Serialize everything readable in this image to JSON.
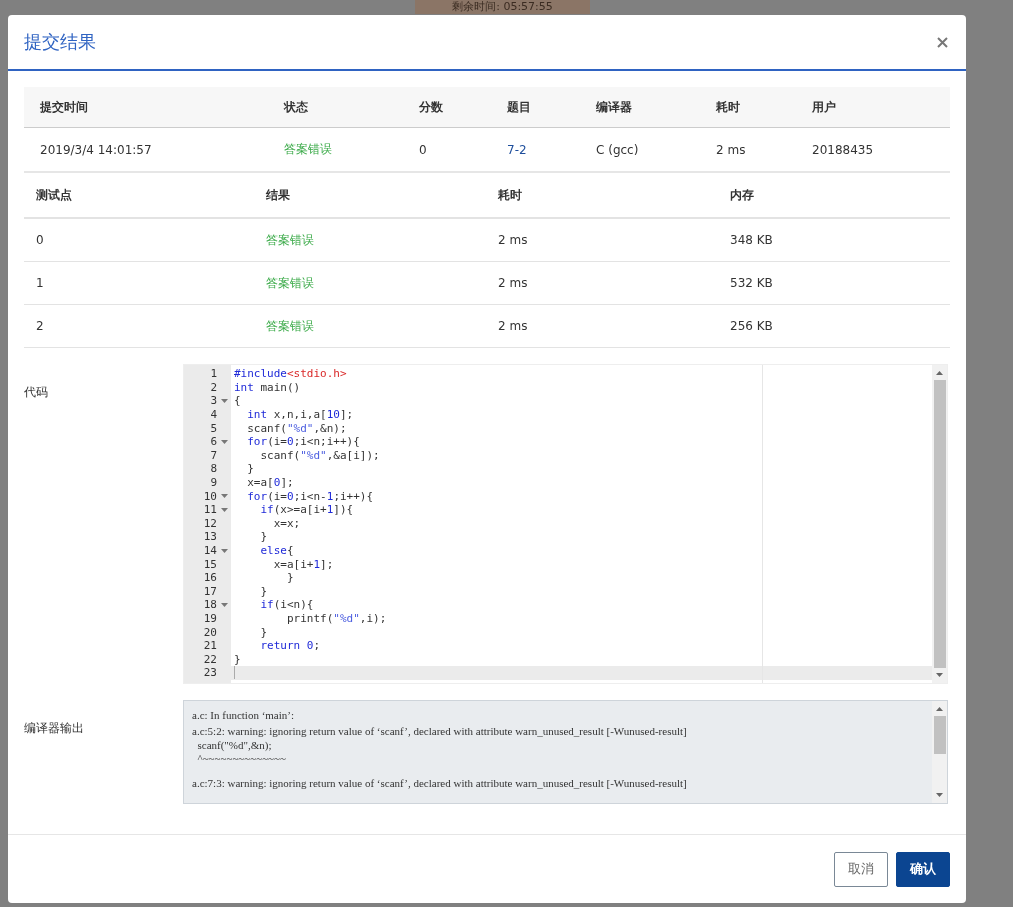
{
  "timer": "剩余时间: 05:57:55",
  "dialog": {
    "title": "提交结果",
    "submission": {
      "columns": [
        "提交时间",
        "状态",
        "分数",
        "题目",
        "编译器",
        "耗时",
        "用户"
      ],
      "row": {
        "time": "2019/3/4 14:01:57",
        "status": "答案错误",
        "score": "0",
        "problem": "7-2",
        "compiler": "C (gcc)",
        "elapsed": "2 ms",
        "user": "20188435"
      }
    },
    "testcases": {
      "columns": [
        "测试点",
        "结果",
        "耗时",
        "内存"
      ],
      "rows": [
        {
          "case": "0",
          "result": "答案错误",
          "elapsed": "2 ms",
          "memory": "348 KB"
        },
        {
          "case": "1",
          "result": "答案错误",
          "elapsed": "2 ms",
          "memory": "532 KB"
        },
        {
          "case": "2",
          "result": "答案错误",
          "elapsed": "2 ms",
          "memory": "256 KB"
        }
      ]
    },
    "code_label": "代码",
    "code": [
      {
        "number": "1",
        "foldable": false,
        "active": false,
        "tokens": [
          {
            "kind": "keyword",
            "text": "#include"
          },
          {
            "kind": "header",
            "text": "<stdio.h>"
          }
        ]
      },
      {
        "number": "2",
        "foldable": false,
        "active": false,
        "tokens": [
          {
            "kind": "keyword",
            "text": "int"
          },
          {
            "kind": "text",
            "text": " main()"
          }
        ]
      },
      {
        "number": "3",
        "foldable": true,
        "active": false,
        "tokens": [
          {
            "kind": "text",
            "text": "{"
          }
        ]
      },
      {
        "number": "4",
        "foldable": false,
        "active": false,
        "tokens": [
          {
            "kind": "keyword",
            "text": "  int"
          },
          {
            "kind": "text",
            "text": " x,n,i,a["
          },
          {
            "kind": "number",
            "text": "10"
          },
          {
            "kind": "text",
            "text": "];"
          }
        ]
      },
      {
        "number": "5",
        "foldable": false,
        "active": false,
        "tokens": [
          {
            "kind": "text",
            "text": "  scanf("
          },
          {
            "kind": "string",
            "text": "\"%d\""
          },
          {
            "kind": "text",
            "text": ",&n);"
          }
        ]
      },
      {
        "number": "6",
        "foldable": true,
        "active": false,
        "tokens": [
          {
            "kind": "keyword",
            "text": "  for"
          },
          {
            "kind": "text",
            "text": "(i="
          },
          {
            "kind": "number",
            "text": "0"
          },
          {
            "kind": "text",
            "text": ";i<n;i++){"
          }
        ]
      },
      {
        "number": "7",
        "foldable": false,
        "active": false,
        "tokens": [
          {
            "kind": "text",
            "text": "    scanf("
          },
          {
            "kind": "string",
            "text": "\"%d\""
          },
          {
            "kind": "text",
            "text": ",&a[i]);"
          }
        ]
      },
      {
        "number": "8",
        "foldable": false,
        "active": false,
        "tokens": [
          {
            "kind": "text",
            "text": "  }"
          }
        ]
      },
      {
        "number": "9",
        "foldable": false,
        "active": false,
        "tokens": [
          {
            "kind": "text",
            "text": "  x=a["
          },
          {
            "kind": "number",
            "text": "0"
          },
          {
            "kind": "text",
            "text": "];"
          }
        ]
      },
      {
        "number": "10",
        "foldable": true,
        "active": false,
        "tokens": [
          {
            "kind": "keyword",
            "text": "  for"
          },
          {
            "kind": "text",
            "text": "(i="
          },
          {
            "kind": "number",
            "text": "0"
          },
          {
            "kind": "text",
            "text": ";i<n-"
          },
          {
            "kind": "number",
            "text": "1"
          },
          {
            "kind": "text",
            "text": ";i++){"
          }
        ]
      },
      {
        "number": "11",
        "foldable": true,
        "active": false,
        "tokens": [
          {
            "kind": "keyword",
            "text": "    if"
          },
          {
            "kind": "text",
            "text": "(x>=a[i+"
          },
          {
            "kind": "number",
            "text": "1"
          },
          {
            "kind": "text",
            "text": "]){"
          }
        ]
      },
      {
        "number": "12",
        "foldable": false,
        "active": false,
        "tokens": [
          {
            "kind": "text",
            "text": "      x=x;"
          }
        ]
      },
      {
        "number": "13",
        "foldable": false,
        "active": false,
        "tokens": [
          {
            "kind": "text",
            "text": "    }"
          }
        ]
      },
      {
        "number": "14",
        "foldable": true,
        "active": false,
        "tokens": [
          {
            "kind": "keyword",
            "text": "    else"
          },
          {
            "kind": "text",
            "text": "{"
          }
        ]
      },
      {
        "number": "15",
        "foldable": false,
        "active": false,
        "tokens": [
          {
            "kind": "text",
            "text": "      x=a[i+"
          },
          {
            "kind": "number",
            "text": "1"
          },
          {
            "kind": "text",
            "text": "];"
          }
        ]
      },
      {
        "number": "16",
        "foldable": false,
        "active": false,
        "tokens": [
          {
            "kind": "text",
            "text": "        }"
          }
        ]
      },
      {
        "number": "17",
        "foldable": false,
        "active": false,
        "tokens": [
          {
            "kind": "text",
            "text": "    }"
          }
        ]
      },
      {
        "number": "18",
        "foldable": true,
        "active": false,
        "tokens": [
          {
            "kind": "keyword",
            "text": "    if"
          },
          {
            "kind": "text",
            "text": "(i<n){"
          }
        ]
      },
      {
        "number": "19",
        "foldable": false,
        "active": false,
        "tokens": [
          {
            "kind": "text",
            "text": "        printf("
          },
          {
            "kind": "string",
            "text": "\"%d\""
          },
          {
            "kind": "text",
            "text": ",i);"
          }
        ]
      },
      {
        "number": "20",
        "foldable": false,
        "active": false,
        "tokens": [
          {
            "kind": "text",
            "text": "    }"
          }
        ]
      },
      {
        "number": "21",
        "foldable": false,
        "active": false,
        "tokens": [
          {
            "kind": "keyword",
            "text": "    return "
          },
          {
            "kind": "number",
            "text": "0"
          },
          {
            "kind": "text",
            "text": ";"
          }
        ]
      },
      {
        "number": "22",
        "foldable": false,
        "active": false,
        "tokens": [
          {
            "kind": "text",
            "text": "}"
          }
        ]
      },
      {
        "number": "23",
        "foldable": false,
        "active": true
      }
    ],
    "compiler_label": "编译器输出",
    "compiler_output": [
      "a.c: In function ‘main’:",
      "a.c:5:2: warning: ignoring return value of ‘scanf’, declared with attribute warn_unused_result [-Wunused-result]",
      "  scanf(\"%d\",&n);",
      "  ^~~~~~~~~~~~~~~",
      "a.c:7:3: warning: ignoring return value of ‘scanf’, declared with attribute warn_unused_result [-Wunused-result]"
    ],
    "buttons": {
      "cancel": "取消",
      "confirm": "确认"
    }
  }
}
